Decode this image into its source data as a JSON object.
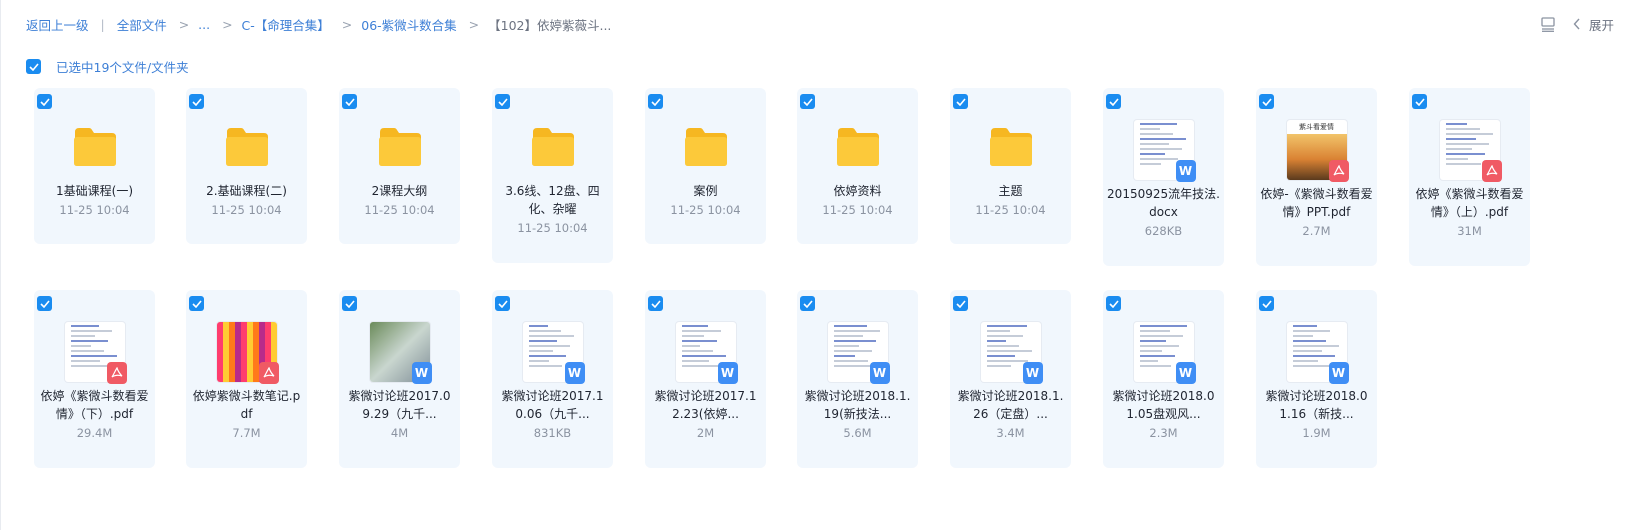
{
  "breadcrumb": {
    "back": "返回上一级",
    "all_files": "全部文件",
    "ellipsis": "...",
    "level1": "C-【命理合集】",
    "level2": "06-紫微斗数合集",
    "current": "【102】依婷紫薇斗..."
  },
  "toolbar": {
    "expand_label": "展开",
    "list_view_icon": "list-view-icon"
  },
  "selection": {
    "summary": "已选中19个文件/文件夹"
  },
  "items": [
    {
      "name": "1基础课程(一)",
      "meta": "11-25 10:04",
      "kind": "folder"
    },
    {
      "name": "2.基础课程(二)",
      "meta": "11-25 10:04",
      "kind": "folder"
    },
    {
      "name": "2课程大纲",
      "meta": "11-25 10:04",
      "kind": "folder"
    },
    {
      "name": "3.6线、12盘、四化、杂曜",
      "meta": "11-25 10:04",
      "kind": "folder"
    },
    {
      "name": "案例",
      "meta": "11-25 10:04",
      "kind": "folder"
    },
    {
      "name": "依婷资料",
      "meta": "11-25 10:04",
      "kind": "folder"
    },
    {
      "name": "主题",
      "meta": "11-25 10:04",
      "kind": "folder"
    },
    {
      "name": "20150925流年技法.docx",
      "meta": "628KB",
      "kind": "word"
    },
    {
      "name": "依婷-《紫微斗数看爱情》PPT.pdf",
      "meta": "2.7M",
      "kind": "pdf",
      "thumb_text": "紫斗看爱情"
    },
    {
      "name": "依婷《紫微斗数看爱情》（上）.pdf",
      "meta": "31M",
      "kind": "pdf"
    },
    {
      "name": "依婷《紫微斗数看爱情》（下）.pdf",
      "meta": "29.4M",
      "kind": "pdf"
    },
    {
      "name": "依婷紫微斗数笔记.pdf",
      "meta": "7.7M",
      "kind": "pdf"
    },
    {
      "name": "紫微讨论班2017.09.29（九千...",
      "meta": "4M",
      "kind": "word"
    },
    {
      "name": "紫微讨论班2017.10.06（九千...",
      "meta": "831KB",
      "kind": "word"
    },
    {
      "name": "紫微讨论班2017.12.23(依婷...",
      "meta": "2M",
      "kind": "word"
    },
    {
      "name": "紫微讨论班2018.1.19(新技法...",
      "meta": "5.6M",
      "kind": "word"
    },
    {
      "name": "紫微讨论班2018.1.26（定盘）...",
      "meta": "3.4M",
      "kind": "word"
    },
    {
      "name": "紫微讨论班2018.01.05盘观风...",
      "meta": "2.3M",
      "kind": "word"
    },
    {
      "name": "紫微讨论班2018.01.16（新技...",
      "meta": "1.9M",
      "kind": "word"
    }
  ],
  "colors": {
    "accent": "#1a8cf0",
    "card_bg": "#f1f7fd",
    "link": "#3d7fd6",
    "folder": "#fcc93a",
    "word": "#3f8ef5",
    "pdf": "#f05a64"
  }
}
